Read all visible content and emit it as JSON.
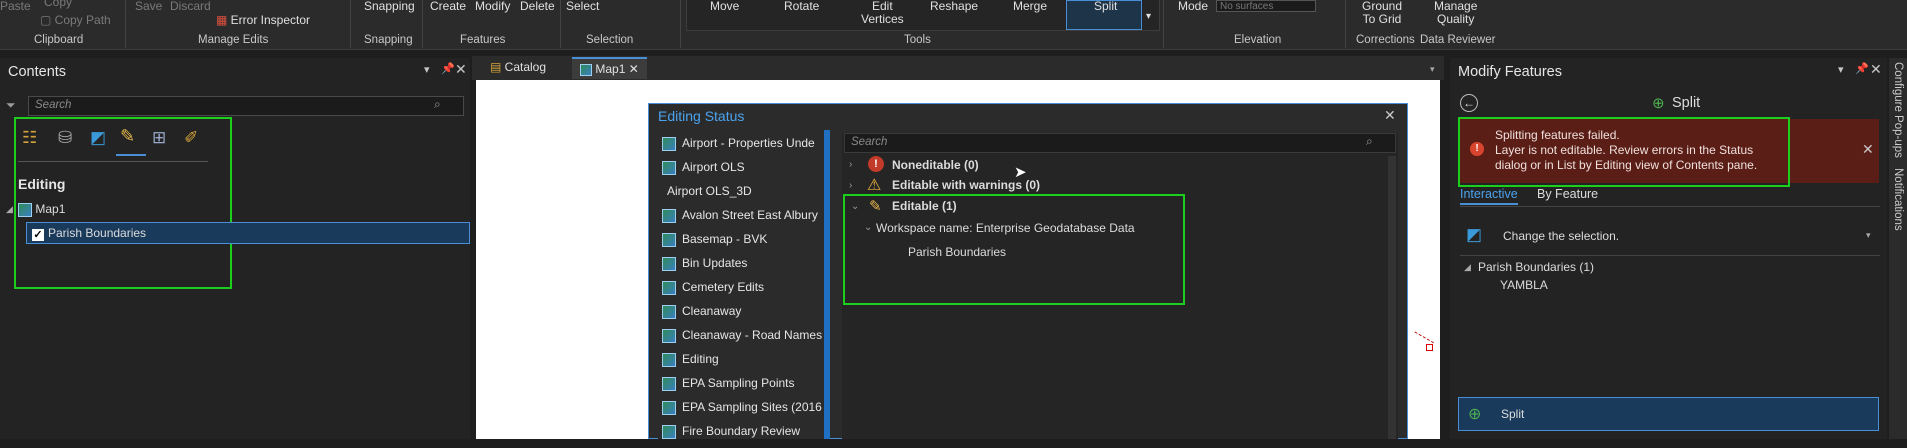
{
  "ribbon": {
    "clipboard": {
      "paste": "Paste",
      "copy": "Copy",
      "copy_path": "Copy Path",
      "label": "Clipboard"
    },
    "manage_edits": {
      "save": "Save",
      "discard": "Discard",
      "error_inspector": "Error Inspector",
      "label": "Manage Edits"
    },
    "snapping": {
      "snapping": "Snapping",
      "label": "Snapping"
    },
    "features": {
      "create": "Create",
      "modify": "Modify",
      "delete": "Delete",
      "label": "Features"
    },
    "selection": {
      "select": "Select",
      "label": "Selection"
    },
    "tools": {
      "move": "Move",
      "rotate": "Rotate",
      "edit_vertices": "Edit\nVertices",
      "reshape": "Reshape",
      "merge": "Merge",
      "split": "Split",
      "label": "Tools"
    },
    "elevation": {
      "mode": "Mode",
      "surface_placeholder": "No surfaces",
      "label": "Elevation"
    },
    "corrections": {
      "ground_to_grid": "Ground\nTo Grid",
      "label": "Corrections"
    },
    "data_reviewer": {
      "manage_quality": "Manage\nQuality",
      "label": "Data Reviewer"
    }
  },
  "contents": {
    "title": "Contents",
    "search_placeholder": "Search",
    "section": "Editing",
    "map": "Map1",
    "layer": "Parish Boundaries"
  },
  "tabs": [
    {
      "label": "Catalog"
    },
    {
      "label": "Map1"
    }
  ],
  "editing_status": {
    "title": "Editing Status",
    "layers": [
      "Airport - Properties Unde",
      "Airport OLS",
      "Airport OLS_3D",
      "Avalon Street East Albury",
      "Basemap - BVK",
      "Bin Updates",
      "Cemetery Edits",
      "Cleanaway",
      "Cleanaway - Road Names",
      "Editing",
      "EPA Sampling Points",
      "EPA Sampling Sites (2016",
      "Fire Boundary Review"
    ],
    "search_placeholder": "Search",
    "noneditable": "Noneditable (0)",
    "warnings": "Editable with warnings (0)",
    "editable": "Editable (1)",
    "workspace": "Workspace name: Enterprise Geodatabase Data",
    "editable_layer": "Parish Boundaries"
  },
  "modify": {
    "title": "Modify Features",
    "tool": "Split",
    "error_line1": "Splitting features failed.",
    "error_line2": "Layer is not editable. Review errors in the Status",
    "error_line3": "dialog or in List by Editing view of Contents pane.",
    "tab_interactive": "Interactive",
    "tab_by_feature": "By Feature",
    "change_selection": "Change the selection.",
    "group": "Parish Boundaries (1)",
    "feature": "YAMBLA",
    "split_button": "Split"
  },
  "side_tabs": {
    "configure": "Configure Pop-ups",
    "notifications": "Notifications"
  },
  "colors": {
    "highlight": "#1ccf1c",
    "accent": "#4a8fd6",
    "error_bg": "#5a1e17"
  }
}
